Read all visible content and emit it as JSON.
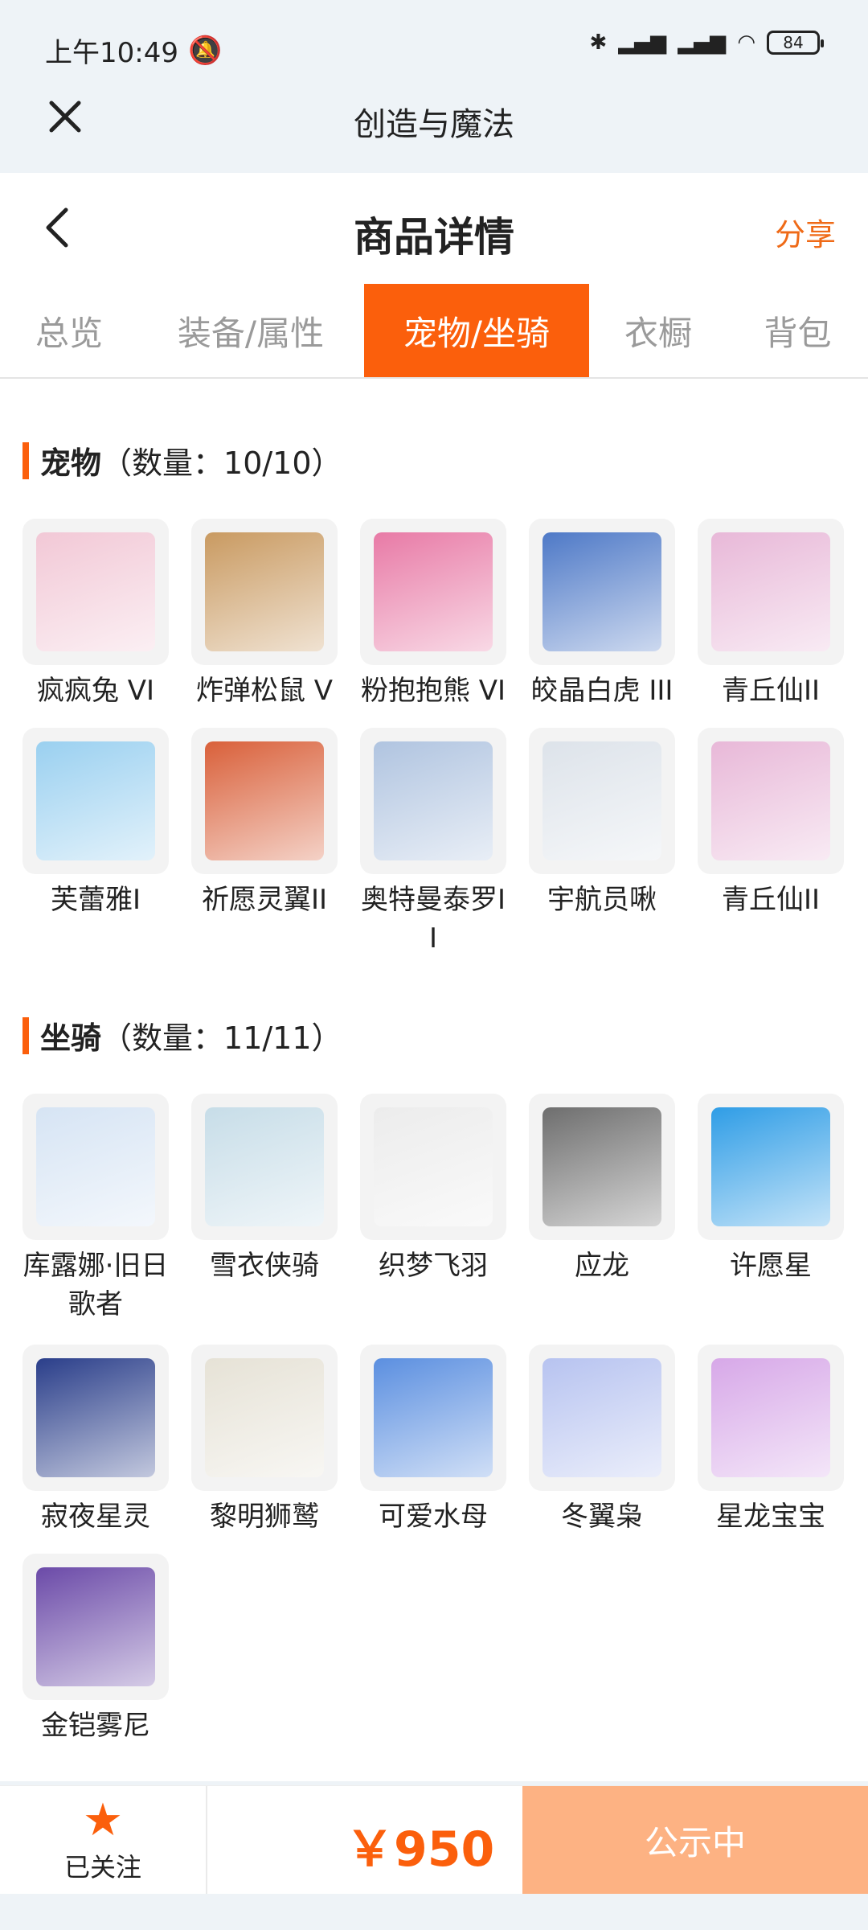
{
  "status_bar": {
    "time": "上午10:49",
    "battery": "84"
  },
  "app": {
    "title": "创造与魔法"
  },
  "page": {
    "title": "商品详情",
    "share_label": "分享"
  },
  "tabs": [
    {
      "label": "总览"
    },
    {
      "label": "装备/属性"
    },
    {
      "label": "宠物/坐骑",
      "active": true
    },
    {
      "label": "衣橱"
    },
    {
      "label": "背包"
    }
  ],
  "pets": {
    "title": "宠物",
    "count": "（数量：10/10）",
    "items": [
      {
        "name": "疯疯兔 VI",
        "color": "#f2c8d6"
      },
      {
        "name": "炸弹松鼠 V",
        "color": "#c99a61"
      },
      {
        "name": "粉抱抱熊 VI",
        "color": "#e87aa6"
      },
      {
        "name": "皎晶白虎 III",
        "color": "#4e79c7"
      },
      {
        "name": "青丘仙II",
        "color": "#e8b8d8"
      },
      {
        "name": "芙蕾雅I",
        "color": "#9ad0f0"
      },
      {
        "name": "祈愿灵翼II",
        "color": "#d9603a"
      },
      {
        "name": "奥特曼泰罗II",
        "color": "#b0c4e0"
      },
      {
        "name": "宇航员啾",
        "color": "#dde3ea"
      },
      {
        "name": "青丘仙II",
        "color": "#e8b8d8"
      }
    ]
  },
  "mounts": {
    "title": "坐骑",
    "count": "（数量：11/11）",
    "items": [
      {
        "name": "库露娜·旧日歌者",
        "color": "#d6e4f4"
      },
      {
        "name": "雪衣侠骑",
        "color": "#c7dde8"
      },
      {
        "name": "织梦飞羽",
        "color": "#ececec"
      },
      {
        "name": "应龙",
        "color": "#6e6e6e"
      },
      {
        "name": "许愿星",
        "color": "#2f9de6"
      },
      {
        "name": "寂夜星灵",
        "color": "#2a3e8a"
      },
      {
        "name": "黎明狮鹫",
        "color": "#e6e2d6"
      },
      {
        "name": "可爱水母",
        "color": "#5b8fe0"
      },
      {
        "name": "冬翼枭",
        "color": "#b7c3f0"
      },
      {
        "name": "星龙宝宝",
        "color": "#d7a8e8"
      },
      {
        "name": "金铠雾尼",
        "color": "#6b4aa8"
      }
    ]
  },
  "footer": {
    "follow_label": "已关注",
    "price": "￥950",
    "status_label": "公示中"
  },
  "colors": {
    "accent": "#fb5f0c",
    "status_button": "#fdb283"
  }
}
